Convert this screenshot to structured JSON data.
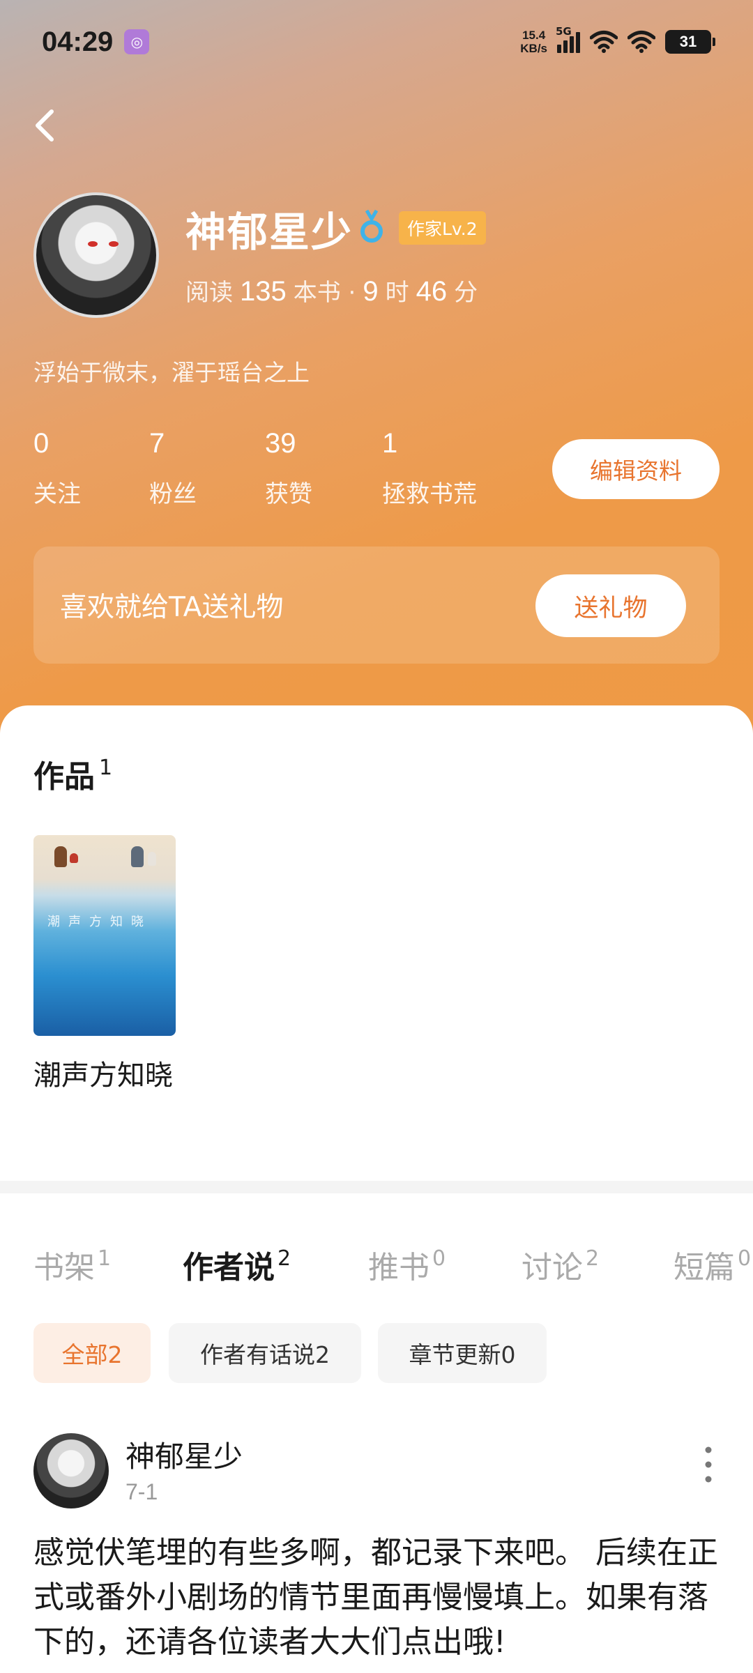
{
  "status_bar": {
    "time": "04:29",
    "net_speed_value": "15.4",
    "net_speed_unit": "KB/s",
    "network_type": "5G",
    "battery_level": "31"
  },
  "profile": {
    "name": "神郁星少",
    "level_badge": "作家Lv.2",
    "read_prefix": "阅读",
    "books_read": "135",
    "books_unit": "本书 ·",
    "hours": "9",
    "hours_unit": "时",
    "minutes": "46",
    "minutes_unit": "分",
    "signature": "浮始于微末，濯于瑶台之上"
  },
  "stats": [
    {
      "value": "0",
      "label": "关注"
    },
    {
      "value": "7",
      "label": "粉丝"
    },
    {
      "value": "39",
      "label": "获赞"
    },
    {
      "value": "1",
      "label": "拯救书荒"
    }
  ],
  "edit_button": "编辑资料",
  "gift": {
    "text": "喜欢就给TA送礼物",
    "button": "送礼物"
  },
  "works": {
    "title": "作品",
    "count": "1",
    "books": [
      {
        "title": "潮声方知晓",
        "cover_text": "潮声方知晓"
      }
    ]
  },
  "tabs": [
    {
      "label": "书架",
      "count": "1"
    },
    {
      "label": "作者说",
      "count": "2"
    },
    {
      "label": "推书",
      "count": "0"
    },
    {
      "label": "讨论",
      "count": "2"
    },
    {
      "label": "短篇",
      "count": "0"
    }
  ],
  "active_tab": "作者说",
  "filters": [
    {
      "label": "全部2"
    },
    {
      "label": "作者有话说2"
    },
    {
      "label": "章节更新0"
    }
  ],
  "post": {
    "author": "神郁星少",
    "date": "7-1",
    "body": "感觉伏笔埋的有些多啊，都记录下来吧。 后续在正式或番外小剧场的情节里面再慢慢填上。如果有落下的，还请各位读者大大们点出哦!"
  },
  "colors": {
    "accent": "#e8742e",
    "level_badge": "#f7b34a",
    "medal": "#3fb3e8"
  }
}
